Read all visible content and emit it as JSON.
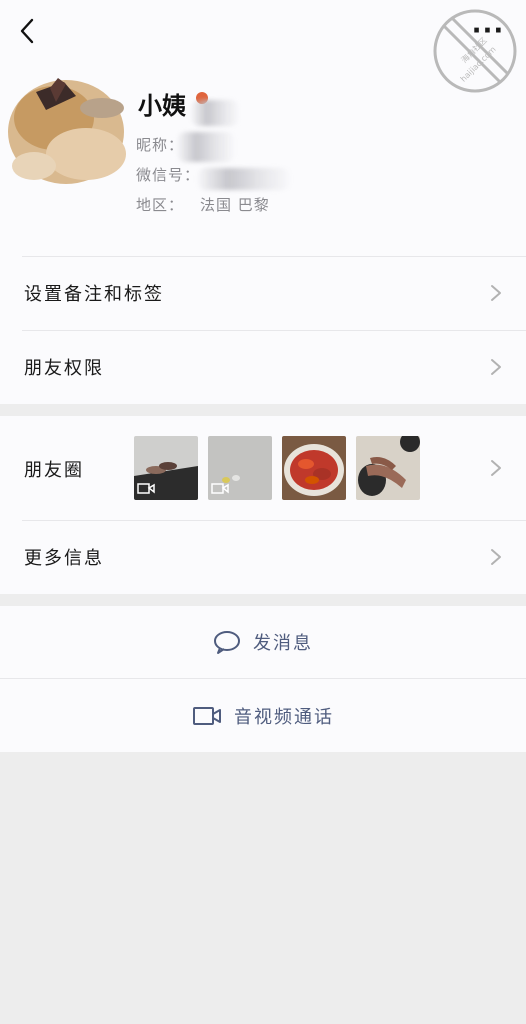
{
  "header": {
    "more_label": "···"
  },
  "profile": {
    "name": "小姨",
    "nickname_label": "昵称：",
    "wechat_id_label": "微信号：",
    "region_label": "地区：",
    "region_value": "法国  巴黎",
    "gender_color": "#e0643c"
  },
  "rows": {
    "remark_tags": "设置备注和标签",
    "friend_permissions": "朋友权限",
    "moments": "朋友圈",
    "more_info": "更多信息"
  },
  "actions": {
    "send_message": "发消息",
    "video_call": "音视频通话"
  },
  "watermark": {
    "line1": "海角社区",
    "line2": "haijiao.com"
  },
  "colors": {
    "action_text": "#4f5c7e",
    "card_bg": "#fbfbfd",
    "page_bg": "#ededed"
  }
}
